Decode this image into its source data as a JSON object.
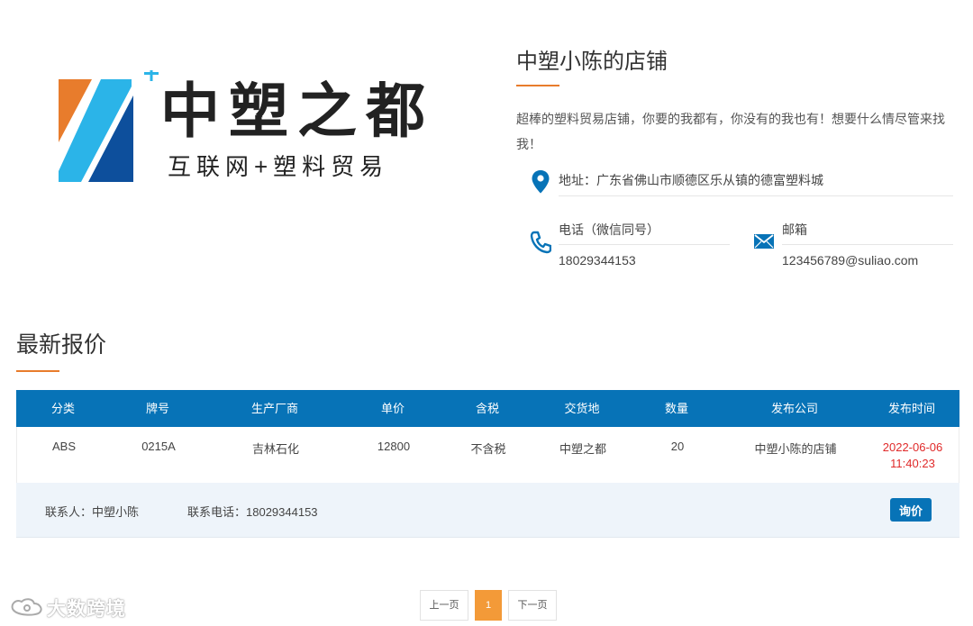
{
  "logo": {
    "title": "中塑之都",
    "subtitle": "互联网+塑料贸易",
    "colors": {
      "orange": "#e87c2c",
      "cyan": "#2bb4e8",
      "navy": "#0d4f9c",
      "plus": "#2bb4e8"
    }
  },
  "shop": {
    "name": "中塑小陈的店铺",
    "description": "超棒的塑料贸易店铺，你要的我都有，你没有的我也有！想要什么情尽管来找我！",
    "address_label": "地址：广东省佛山市顺德区乐从镇的德富塑料城",
    "phone_label": "电话（微信同号）",
    "phone_value": "18029344153",
    "email_label": "邮箱",
    "email_value": "123456789@suliao.com",
    "icons": {
      "address": "location-pin-icon",
      "phone": "phone-icon",
      "email": "mail-icon"
    }
  },
  "quotes": {
    "title": "最新报价",
    "columns": [
      "分类",
      "牌号",
      "生产厂商",
      "单价",
      "含税",
      "交货地",
      "数量",
      "发布公司",
      "发布时间"
    ],
    "rows": [
      {
        "category": "ABS",
        "grade": "0215A",
        "manufacturer": "吉林石化",
        "price": "12800",
        "tax": "不含税",
        "delivery": "中塑之都",
        "quantity": "20",
        "company": "中塑小陈的店铺",
        "date": "2022-06-06",
        "time": "11:40:23",
        "contact_person": "联系人：中塑小陈",
        "contact_phone": "联系电话：18029344153",
        "inquiry_label": "询价"
      }
    ]
  },
  "pagination": {
    "prev": "上一页",
    "current": "1",
    "next": "下一页"
  },
  "watermark": "大数跨境",
  "colors": {
    "accent": "#e87c2c",
    "header_blue": "#0773b7",
    "pager_active": "#f39a38",
    "date_red": "#e02a2a"
  }
}
